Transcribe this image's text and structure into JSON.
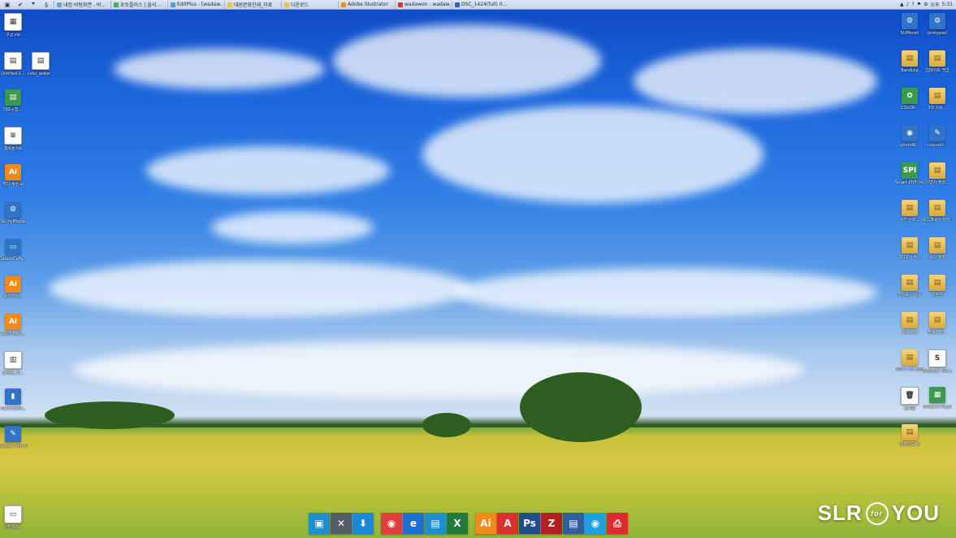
{
  "taskbar": {
    "quick": [
      "▣",
      "✔",
      "⯆",
      "§"
    ],
    "tasks": [
      {
        "label": "내컴 바탕화면 - 바...",
        "color": "#6a9fd8"
      },
      {
        "label": "포토플러스 | 올리...",
        "color": "#4caf50"
      },
      {
        "label": "EditPlus - [wadaw...",
        "color": "#5b9bd5"
      },
      {
        "label": "대원문화인쇄_자료",
        "color": "#f0c040"
      },
      {
        "label": "다운로드",
        "color": "#f0c040"
      },
      {
        "label": "Adobe Illustrator",
        "color": "#f08a1a"
      },
      {
        "label": "wadawon - wadaw...",
        "color": "#e03030"
      },
      {
        "label": "DSC_1424(full) 0...",
        "color": "#3060c0"
      }
    ],
    "tray": {
      "icons": [
        "▲",
        "♪",
        "?",
        "⚑",
        "⚙"
      ],
      "lang": "오후",
      "time": "5:31"
    }
  },
  "left_icons": [
    {
      "label": "구글.zip",
      "kind": "doc",
      "glyph": "▦"
    },
    {
      "label": "Untitled-1...",
      "kind": "doc",
      "glyph": "▤"
    },
    {
      "label": "cvku_water...",
      "kind": "doc",
      "glyph": "▤"
    },
    {
      "label": "대도곳잡...",
      "kind": "green",
      "glyph": "▤"
    },
    {
      "label": "홈폭돌.txt",
      "kind": "doc",
      "glyph": "≡"
    },
    {
      "label": "부디 새론.ai",
      "kind": "ai",
      "glyph": "Ai"
    },
    {
      "label": "Sa_nsPhobe",
      "kind": "blue",
      "glyph": "⚙"
    },
    {
      "label": "GalaxyCaFe...",
      "kind": "blue",
      "glyph": "▭"
    },
    {
      "label": "꽃산이상...",
      "kind": "ai",
      "glyph": "Ai"
    },
    {
      "label": "모인렇게_운...",
      "kind": "ai",
      "glyph": "Ai"
    },
    {
      "label": "pck숨_사...",
      "kind": "doc",
      "glyph": "▥"
    },
    {
      "label": "Hubertmilk...",
      "kind": "blue",
      "glyph": "▮"
    },
    {
      "label": "Google Web Designer",
      "kind": "blue",
      "glyph": "✎"
    },
    {
      "label": "사진게크...",
      "kind": "doc",
      "glyph": "▭"
    }
  ],
  "right_icons": [
    {
      "label": "SUMonet",
      "kind": "blue",
      "glyph": "⚙"
    },
    {
      "label": "protypoel",
      "kind": "blue",
      "glyph": "⚙"
    },
    {
      "label": "Bandizip",
      "kind": "folder",
      "glyph": "▤"
    },
    {
      "label": "업데이트 백업",
      "kind": "folder",
      "glyph": "▤"
    },
    {
      "label": "COLOR...",
      "kind": "green",
      "glyph": "✿"
    },
    {
      "label": "3차 이용...",
      "kind": "folder",
      "glyph": "▤"
    },
    {
      "label": "photoW...",
      "kind": "blue",
      "glyph": "◉"
    },
    {
      "label": "ruleunit...",
      "kind": "blue",
      "glyph": "✎"
    },
    {
      "label": "Smart PDF Imposition",
      "kind": "green",
      "glyph": "SPI"
    },
    {
      "label": "시업지 출력...",
      "kind": "folder",
      "glyph": "▤"
    },
    {
      "label": "사진 원력...",
      "kind": "folder",
      "glyph": "▤"
    },
    {
      "label": "워드파워셀 파일 보관",
      "kind": "folder",
      "glyph": "▤"
    },
    {
      "label": "2015년 정...",
      "kind": "folder",
      "glyph": "▤"
    },
    {
      "label": "광고 행별",
      "kind": "folder",
      "glyph": "▤"
    },
    {
      "label": "앞으로는 사용",
      "kind": "folder",
      "glyph": "▤"
    },
    {
      "label": "그림한",
      "kind": "folder",
      "glyph": "▤"
    },
    {
      "label": "프로그램",
      "kind": "folder",
      "glyph": "▤"
    },
    {
      "label": "블로그하...",
      "kind": "folder",
      "glyph": "▤"
    },
    {
      "label": "네이버 서버 일반설",
      "kind": "folder",
      "glyph": "▤"
    },
    {
      "label": "SubBlue Text 3",
      "kind": "doc",
      "glyph": "S"
    },
    {
      "label": "휴지통",
      "kind": "doc",
      "glyph": "🗑"
    },
    {
      "label": "VMware Player",
      "kind": "green",
      "glyph": "▦"
    },
    {
      "label": "원본인보 팍",
      "kind": "folder",
      "glyph": "▤"
    }
  ],
  "dock": [
    {
      "name": "explorer",
      "glyph": "▣",
      "color": "#1b8fd0"
    },
    {
      "name": "tools",
      "glyph": "✕",
      "color": "#555c66"
    },
    {
      "name": "download",
      "glyph": "⬇",
      "color": "#1d88d6"
    },
    {
      "name": "chrome",
      "glyph": "◉",
      "color": "#e23d3d"
    },
    {
      "name": "ie",
      "glyph": "e",
      "color": "#1b6fd0"
    },
    {
      "name": "notes",
      "glyph": "▤",
      "color": "#1b8fd0"
    },
    {
      "name": "excel",
      "glyph": "X",
      "color": "#1f7a3d"
    },
    {
      "name": "illustrator",
      "glyph": "Ai",
      "color": "#f08a1a"
    },
    {
      "name": "acrobat",
      "glyph": "A",
      "color": "#d93030"
    },
    {
      "name": "photoshop",
      "glyph": "Ps",
      "color": "#1f4e8c"
    },
    {
      "name": "filezilla",
      "glyph": "Z",
      "color": "#b22020"
    },
    {
      "name": "word-doc",
      "glyph": "▤",
      "color": "#2d5fa0"
    },
    {
      "name": "messenger",
      "glyph": "◉",
      "color": "#1da1e0"
    },
    {
      "name": "printer",
      "glyph": "⎙",
      "color": "#e0282e"
    }
  ],
  "watermark": {
    "left": "SLR",
    "mid": "for",
    "right": "YOU"
  }
}
